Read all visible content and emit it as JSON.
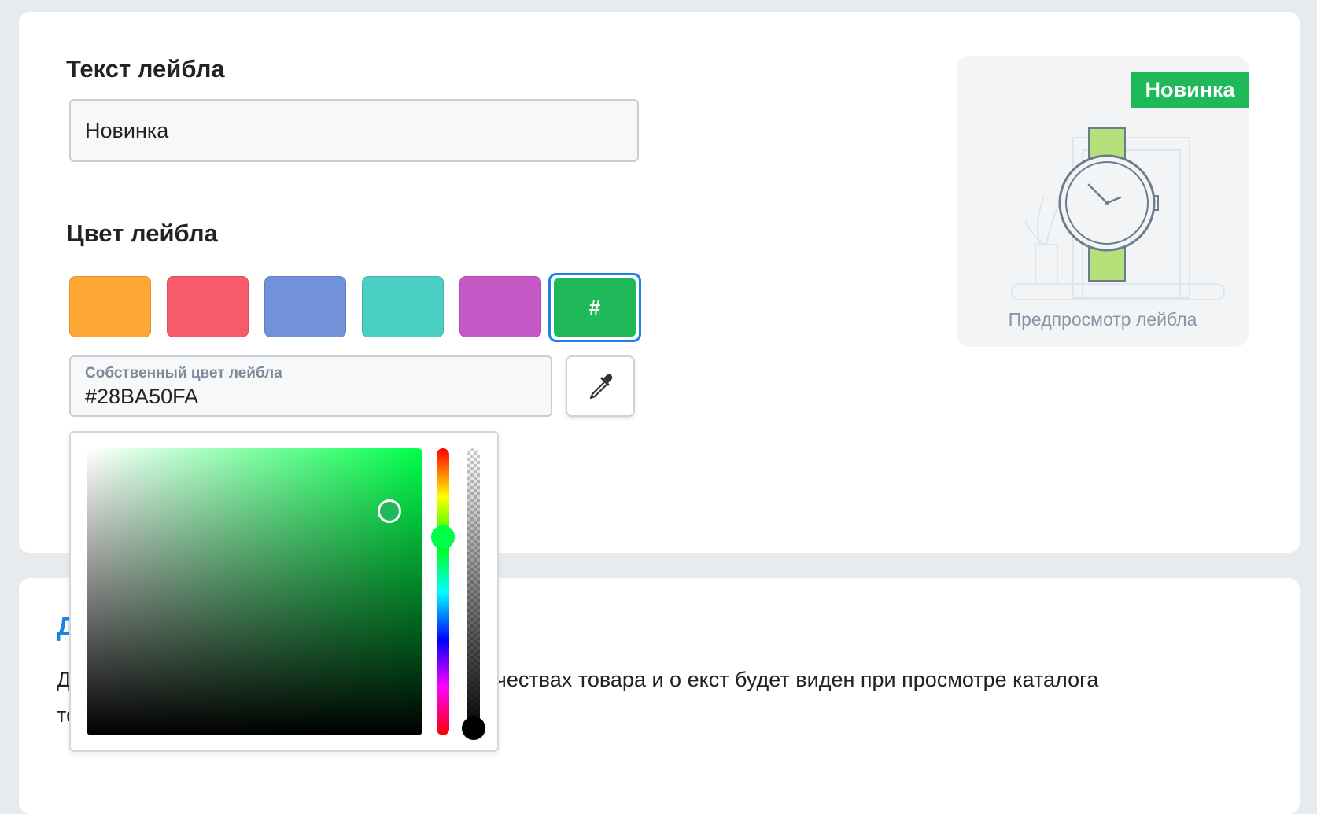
{
  "label_text": {
    "heading": "Текст лейбла",
    "value": "Новинка"
  },
  "label_color": {
    "heading": "Цвет лейбла",
    "swatches": [
      "#ffa735",
      "#f65b69",
      "#7191d9",
      "#4bcfc3",
      "#c458c4"
    ],
    "custom_swatch": {
      "color": "#20b95a",
      "symbol": "#",
      "selected": true
    },
    "custom_field_label": "Собственный цвет лейбла",
    "custom_field_value": "#28BA50FA",
    "pipette_icon": "eyedropper-icon"
  },
  "preview": {
    "badge_text": "Новинка",
    "badge_color": "#20b95a",
    "caption": "Предпросмотр лейбла",
    "image_icon": "watch-illustration"
  },
  "picker": {
    "hue_color": "#00ff49",
    "selected_color": "#20b95a"
  },
  "bottom_section": {
    "heading": "Д",
    "text": "Д                                              описанием, чтобы рассказать о важных качествах товара и о                                              екст будет виден при просмотре каталога товаров и страницы выбранного товара."
  }
}
